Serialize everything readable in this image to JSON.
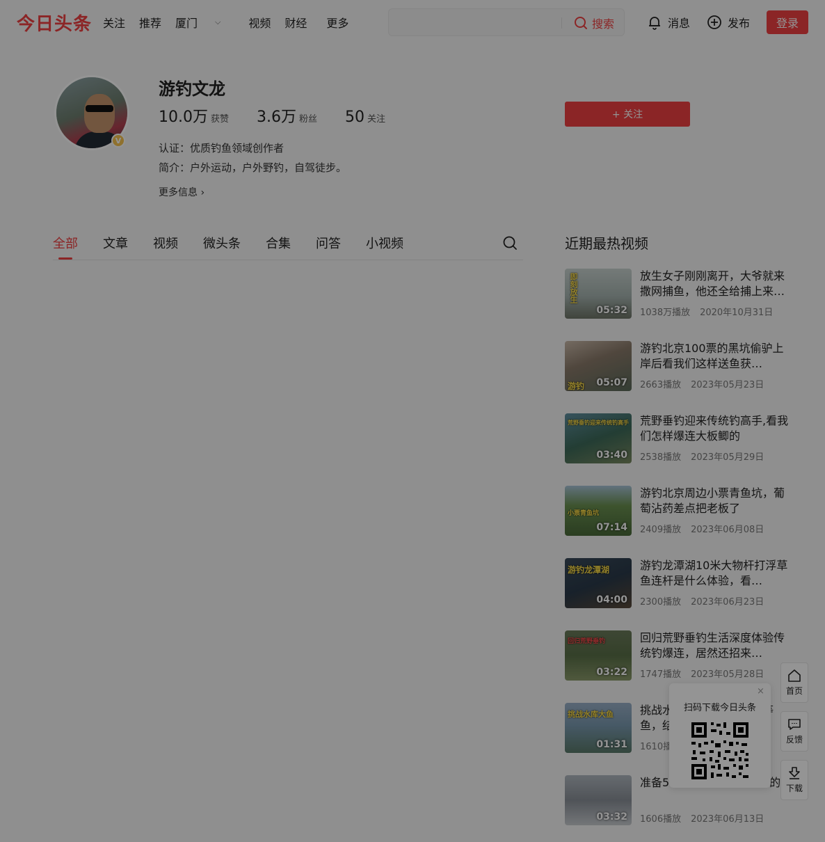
{
  "header": {
    "logo": "今日头条",
    "nav": [
      "关注",
      "推荐",
      "厦门",
      "视频",
      "财经",
      "更多"
    ],
    "search_placeholder": "",
    "search_label": "搜索",
    "messages_label": "消息",
    "publish_label": "发布",
    "login_label": "登录"
  },
  "profile": {
    "name": "游钓文龙",
    "likes_num": "10.0万",
    "likes_label": "获赞",
    "fans_num": "3.6万",
    "fans_label": "粉丝",
    "following_num": "50",
    "following_label": "关注",
    "certification": "认证：优质钓鱼领域创作者",
    "bio": "简介：户外运动，户外野钓，自驾徒步。",
    "more_info": "更多信息 ›",
    "follow_button": "+ 关注",
    "verify_badge": "V"
  },
  "tabs": [
    "全部",
    "文章",
    "视频",
    "微头条",
    "合集",
    "问答",
    "小视频"
  ],
  "sidebar": {
    "title": "近期最热视频",
    "videos": [
      {
        "title": "放生女子刚刚离开，大爷就来撒网捕鱼，他还全给捕上来…",
        "plays": "1038万播放",
        "date": "2020年10月31日",
        "duration": "05:32",
        "tag": "即刻放生"
      },
      {
        "title": "游钓北京100票的黑坑偷驴上岸后看我们这样送鱼获…",
        "plays": "2663播放",
        "date": "2023年05月23日",
        "duration": "05:07",
        "tag": "游钓"
      },
      {
        "title": "荒野垂钓迎来传统钓高手,看我们怎样爆连大板鲫的",
        "plays": "2538播放",
        "date": "2023年05月29日",
        "duration": "03:40",
        "tag": "荒野垂钓迎来传统钓高手"
      },
      {
        "title": "游钓北京周边小票青鱼坑，葡萄沾药差点把老板了",
        "plays": "2409播放",
        "date": "2023年06月08日",
        "duration": "07:14",
        "tag": "小票青鱼坑"
      },
      {
        "title": "游钓龙潭湖10米大物杆打浮草鱼连杆是什么体验，看…",
        "plays": "2300播放",
        "date": "2023年06月23日",
        "duration": "04:00",
        "tag": "游钓龙潭湖"
      },
      {
        "title": "回归荒野垂钓生活深度体验传统钓爆连，居然还招来…",
        "plays": "1747播放",
        "date": "2023年05月28日",
        "duration": "03:22",
        "tag": "回归荒野垂钓"
      },
      {
        "title": "挑战水库大鱼，开始打窝等鱼，结果…",
        "plays": "1610播放",
        "date": "",
        "duration": "01:31",
        "tag": "挑战水库大鱼"
      },
      {
        "title": "准备5…要奔着水库大鱼去的",
        "plays": "1606播放",
        "date": "2023年06月13日",
        "duration": "03:32",
        "tag": ""
      }
    ]
  },
  "float": {
    "home": "首页",
    "feedback": "反馈",
    "download": "下载",
    "qr_title": "扫码下载今日头条",
    "qr_close": "×"
  },
  "colors": {
    "brand": "#f04142"
  }
}
